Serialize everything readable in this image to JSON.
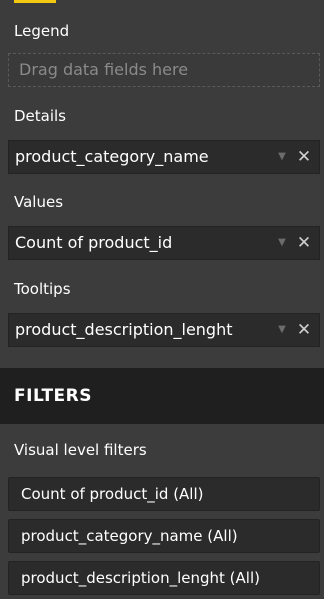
{
  "wells": {
    "legend": {
      "label": "Legend",
      "placeholder": "Drag data fields here"
    },
    "details": {
      "label": "Details",
      "field": "product_category_name"
    },
    "values": {
      "label": "Values",
      "field": "Count of product_id"
    },
    "tooltips": {
      "label": "Tooltips",
      "field": "product_description_lenght"
    }
  },
  "filters": {
    "title": "FILTERS",
    "section": "Visual level filters",
    "items": [
      "Count of product_id  (All)",
      "product_category_name  (All)",
      "product_description_lenght  (All)"
    ]
  },
  "icons": {
    "chevron": "chevron-down-icon",
    "remove": "close-icon"
  },
  "colors": {
    "panel_bg": "#3c3c3c",
    "field_bg": "#2b2b2b",
    "header_bg": "#1f1f1f",
    "accent": "#f2c811"
  }
}
